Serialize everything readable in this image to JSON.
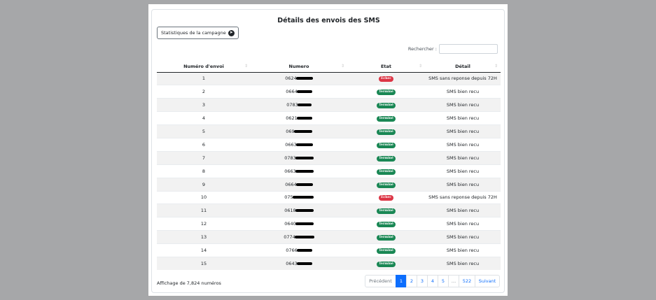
{
  "title": "Détails des envois des SMS",
  "stats_button": {
    "label": "Statistiques de la campagne",
    "icon": "arrow-circle-icon"
  },
  "search": {
    "label": "Rechercher :",
    "value": "",
    "placeholder": ""
  },
  "table": {
    "columns": [
      "Numéro d'envoi",
      "Numero",
      "Etat",
      "Détail"
    ],
    "rows": [
      {
        "id": "1",
        "numero": "0624",
        "etat": "Echec",
        "detail": "SMS sans reponse depuis 72H"
      },
      {
        "id": "2",
        "numero": "0664",
        "etat": "Terminé",
        "detail": "SMS bien recu"
      },
      {
        "id": "3",
        "numero": "0783",
        "etat": "Terminé",
        "detail": "SMS bien recu"
      },
      {
        "id": "4",
        "numero": "0621",
        "etat": "Terminé",
        "detail": "SMS bien recu"
      },
      {
        "id": "5",
        "numero": "069",
        "etat": "Terminé",
        "detail": "SMS bien recu"
      },
      {
        "id": "6",
        "numero": "0663",
        "etat": "Terminé",
        "detail": "SMS bien recu"
      },
      {
        "id": "7",
        "numero": "0783",
        "etat": "Terminé",
        "detail": "SMS bien recu"
      },
      {
        "id": "8",
        "numero": "0663",
        "etat": "Terminé",
        "detail": "SMS bien recu"
      },
      {
        "id": "9",
        "numero": "0664",
        "etat": "Terminé",
        "detail": "SMS bien recu"
      },
      {
        "id": "10",
        "numero": "075",
        "etat": "Echec",
        "detail": "SMS sans reponse depuis 72H"
      },
      {
        "id": "11",
        "numero": "0618",
        "etat": "Terminé",
        "detail": "SMS bien recu"
      },
      {
        "id": "12",
        "numero": "0640",
        "etat": "Terminé",
        "detail": "SMS bien recu"
      },
      {
        "id": "13",
        "numero": "0774",
        "etat": "Terminé",
        "detail": "SMS bien recu"
      },
      {
        "id": "14",
        "numero": "0766",
        "etat": "Terminé",
        "detail": "SMS bien recu"
      },
      {
        "id": "15",
        "numero": "0643",
        "etat": "Terminé",
        "detail": "SMS bien recu"
      }
    ]
  },
  "footer": {
    "info": "Affichage de 7,824 numéros",
    "pagination": [
      "Précédent",
      "1",
      "2",
      "3",
      "4",
      "5",
      "…",
      "522",
      "Suivant"
    ],
    "active_page": "1"
  },
  "colors": {
    "success": "#198754",
    "danger": "#dc3545",
    "primary": "#0d6efd"
  }
}
